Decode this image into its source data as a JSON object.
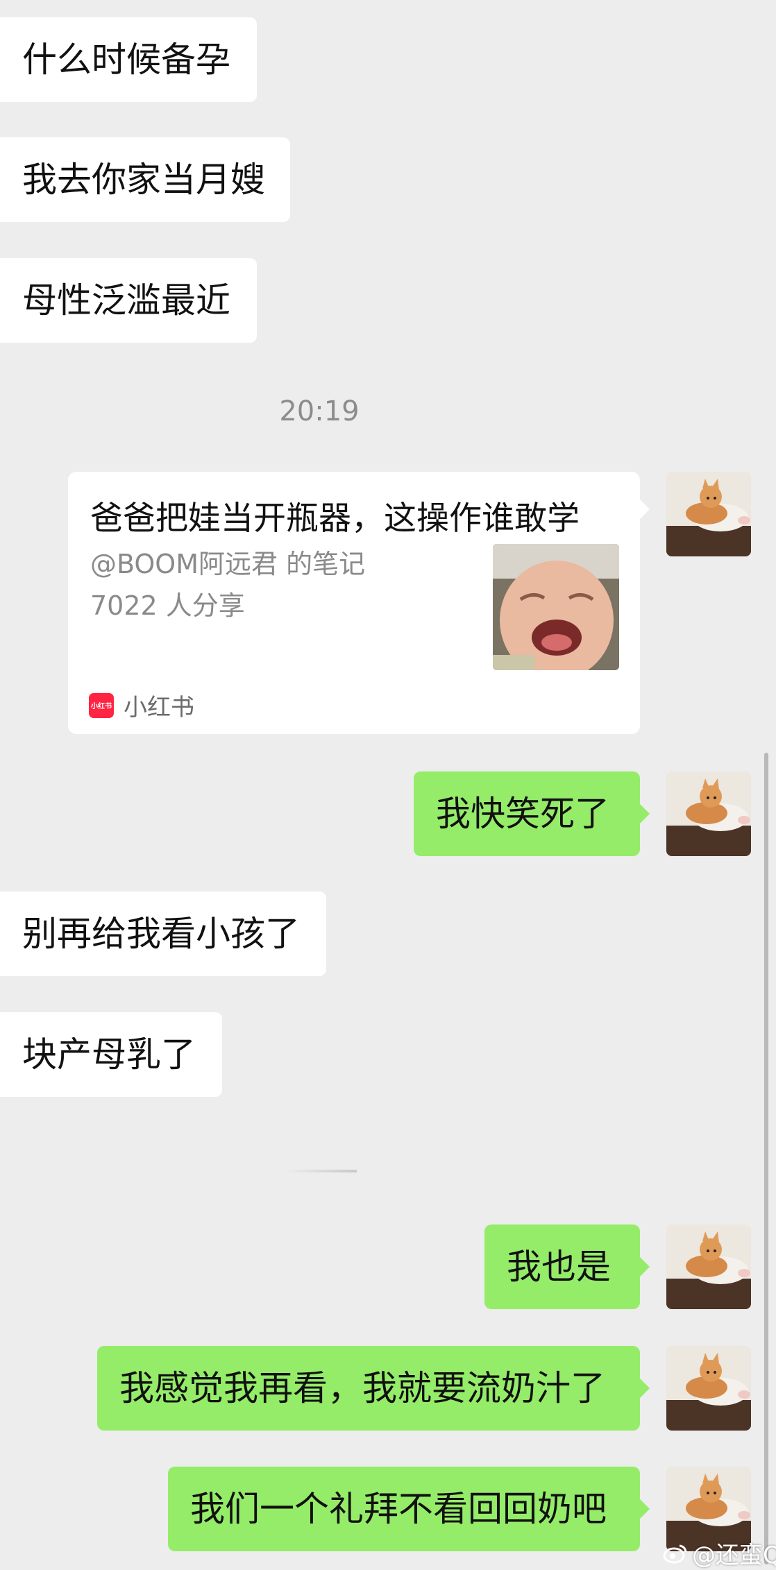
{
  "chat": {
    "messages_top": [
      {
        "side": "left",
        "text": "什么时候备孕"
      },
      {
        "side": "left",
        "text": "我去你家当月嫂"
      },
      {
        "side": "left",
        "text": "母性泛滥最近"
      }
    ],
    "timestamp": "20:19",
    "shared_card": {
      "title": "爸爸把娃当开瓶器，这操作谁敢学",
      "author": "@BOOM阿远君 的笔记",
      "shares": "7022 人分享",
      "app_logo_text": "小红书",
      "app_name": "小红书"
    },
    "messages_bottom": [
      {
        "side": "right",
        "text": "我快笑死了"
      },
      {
        "side": "left",
        "text": "别再给我看小孩了"
      },
      {
        "side": "left",
        "text": "块产母乳了"
      },
      {
        "side": "right",
        "text": "我也是"
      },
      {
        "side": "right",
        "text": "我感觉我再看，我就要流奶汁了"
      },
      {
        "side": "right",
        "text": "我们一个礼拜不看回回奶吧"
      }
    ]
  },
  "watermark": {
    "text": "@还蛮Q",
    "icon": "weibo-icon"
  },
  "colors": {
    "background": "#ededed",
    "outgoing_bubble": "#95ec69",
    "incoming_bubble": "#ffffff",
    "brand_red": "#ff2442"
  }
}
